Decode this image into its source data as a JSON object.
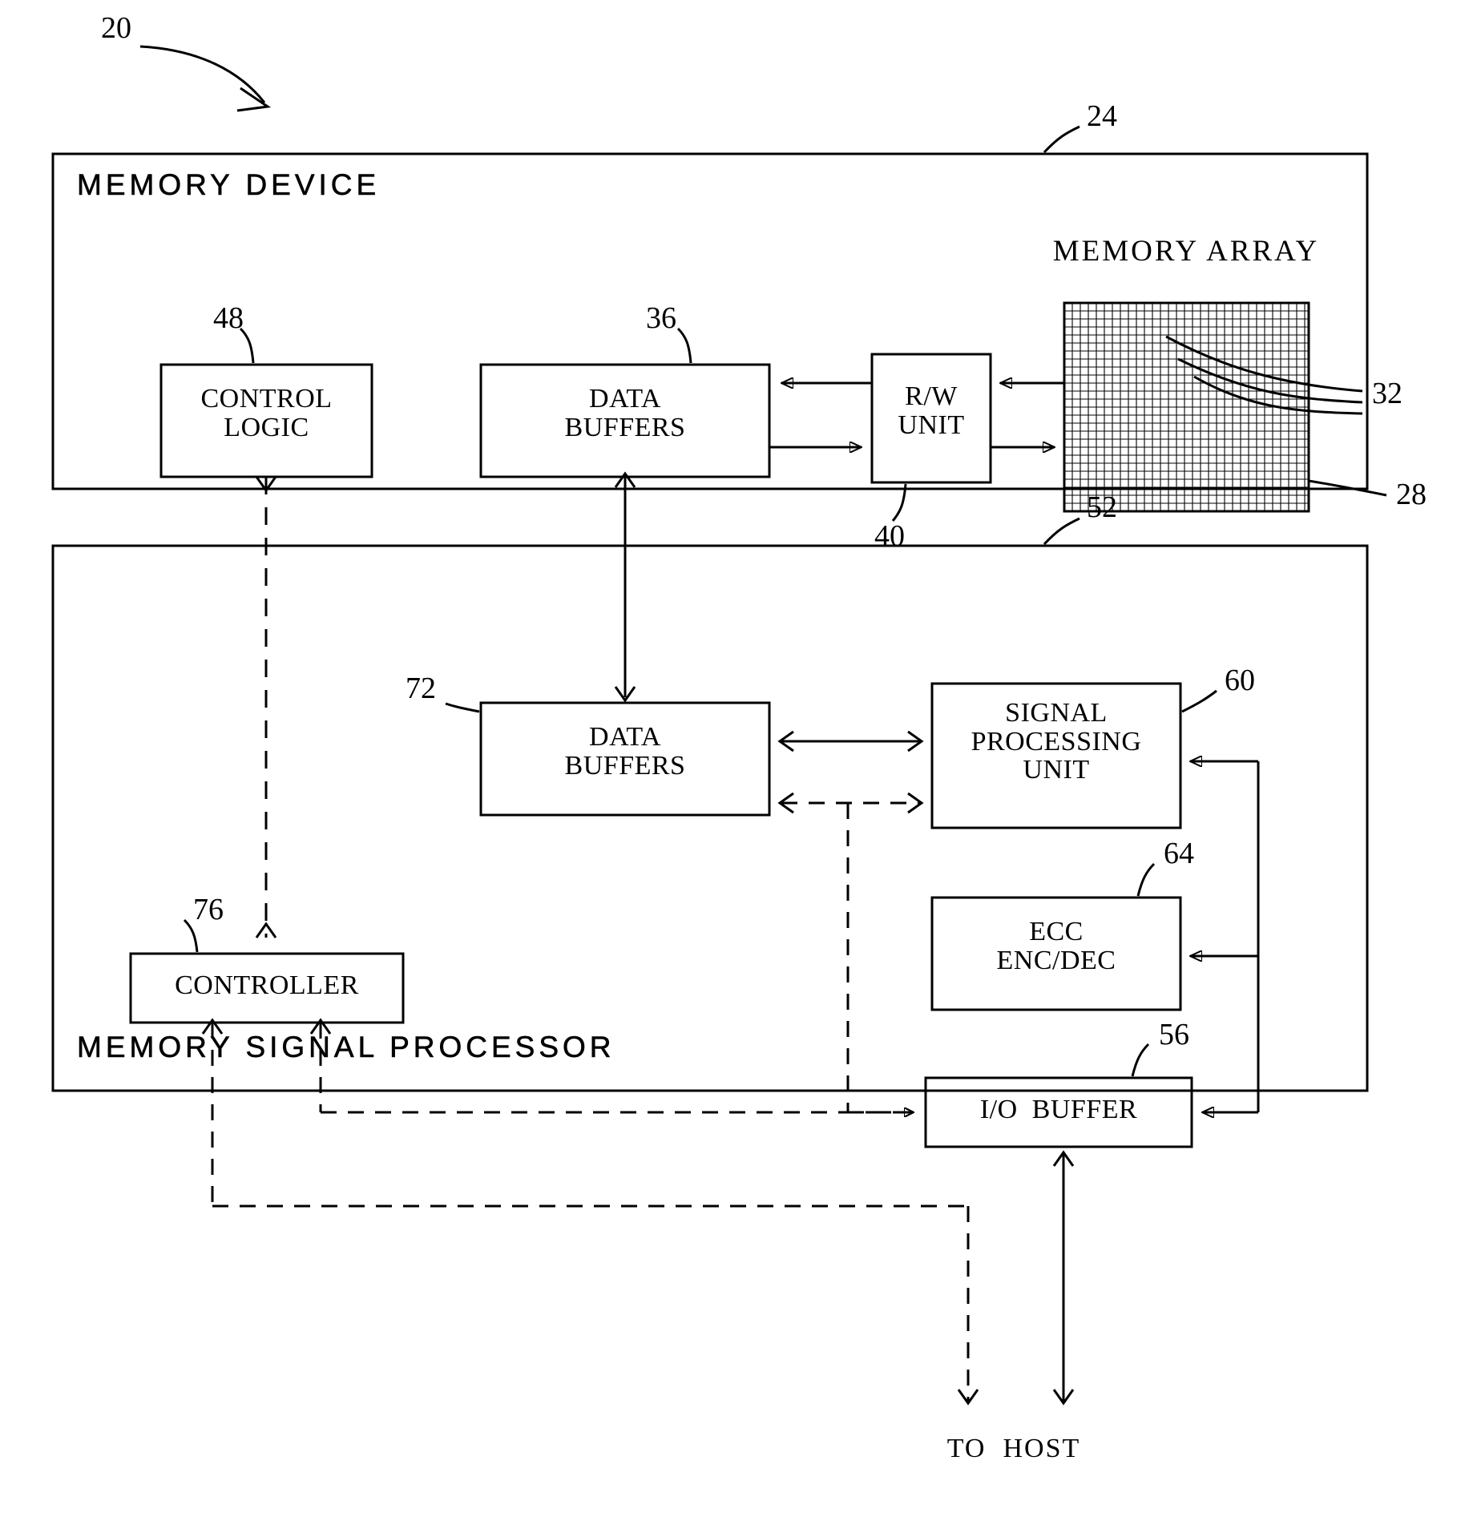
{
  "figure": {
    "fig_ref": "20",
    "outer_blocks": [
      {
        "id": "memory-device",
        "title": "MEMORY DEVICE",
        "ref": "24"
      },
      {
        "id": "memory-signal-processor",
        "title": "MEMORY SIGNAL PROCESSOR",
        "ref": "52"
      }
    ],
    "memory_array": {
      "title": "MEMORY ARRAY",
      "ref_rows": "32",
      "ref_cols": "28"
    },
    "blocks": [
      {
        "id": "control-logic",
        "label": "CONTROL\nLOGIC",
        "ref": "48"
      },
      {
        "id": "data-buffers-device",
        "label": "DATA\nBUFFERS",
        "ref": "36"
      },
      {
        "id": "rw-unit",
        "label": "R/W\nUNIT",
        "ref": "40"
      },
      {
        "id": "data-buffers-msp",
        "label": "DATA\nBUFFERS",
        "ref": "72"
      },
      {
        "id": "signal-processing-unit",
        "label": "SIGNAL\nPROCESSING\nUNIT",
        "ref": "60"
      },
      {
        "id": "ecc-enc-dec",
        "label": "ECC\nENC/DEC",
        "ref": "64"
      },
      {
        "id": "io-buffer",
        "label": "I/O  BUFFER",
        "ref": "56"
      },
      {
        "id": "controller",
        "label": "CONTROLLER",
        "ref": "76"
      }
    ],
    "annotations": [
      {
        "id": "to-host",
        "label": "TO  HOST"
      }
    ]
  }
}
